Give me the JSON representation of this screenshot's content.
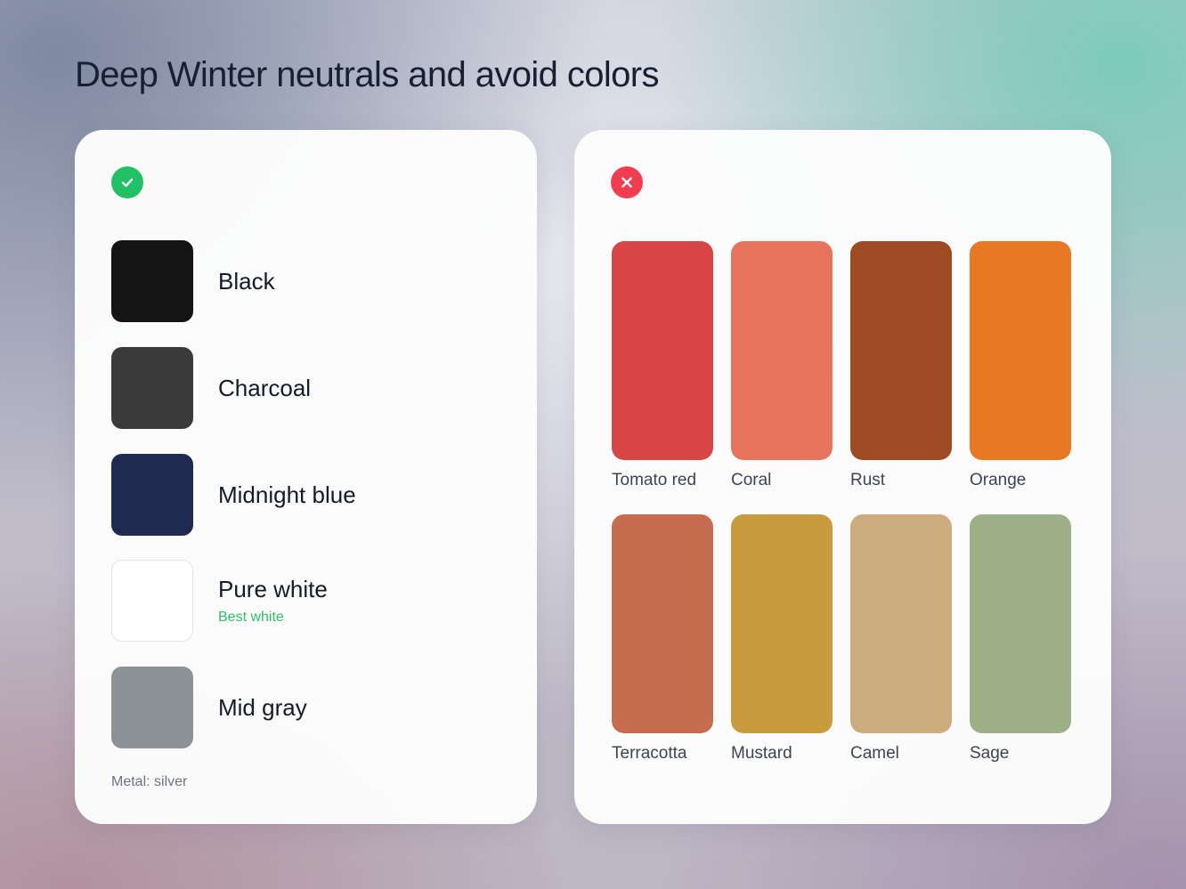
{
  "title": "Deep Winter neutrals and avoid colors",
  "neutrals": {
    "badge_icon": "check-icon",
    "badge_color": "#22c064",
    "items": [
      {
        "label": "Black",
        "color": "#141414"
      },
      {
        "label": "Charcoal",
        "color": "#3a3a3b"
      },
      {
        "label": "Midnight blue",
        "color": "#1f2a50"
      },
      {
        "label": "Pure white",
        "color": "#ffffff",
        "note": "Best white"
      },
      {
        "label": "Mid gray",
        "color": "#8d9296"
      }
    ],
    "metal": "Metal: silver"
  },
  "avoid": {
    "badge_icon": "close-icon",
    "badge_color": "#f13d4f",
    "items": [
      {
        "label": "Tomato red",
        "color": "#d84545"
      },
      {
        "label": "Coral",
        "color": "#e6745c"
      },
      {
        "label": "Rust",
        "color": "#9e4a23"
      },
      {
        "label": "Orange",
        "color": "#e87824"
      },
      {
        "label": "Terracotta",
        "color": "#c76c50"
      },
      {
        "label": "Mustard",
        "color": "#c89c3e"
      },
      {
        "label": "Camel",
        "color": "#ccab7e"
      },
      {
        "label": "Sage",
        "color": "#9db088"
      }
    ]
  }
}
